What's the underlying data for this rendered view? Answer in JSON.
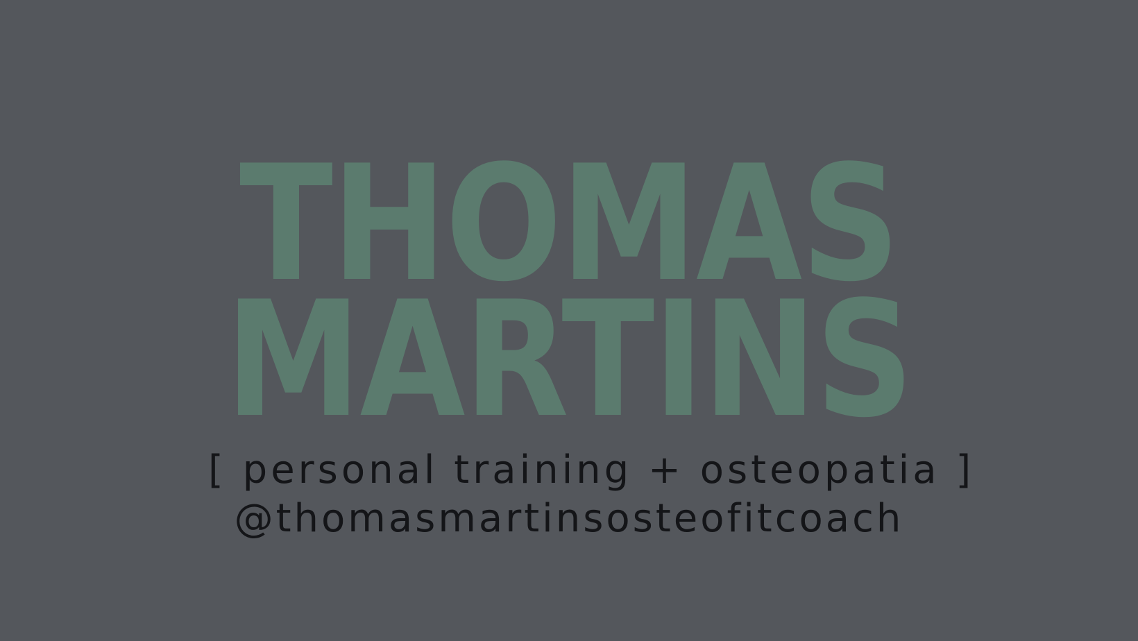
{
  "logo": {
    "first_name": "THOMAS",
    "last_name": "MARTINS",
    "color": "#5b7b6e"
  },
  "tagline": "[ personal training + osteopatia ]",
  "handle": "@thomasmartinsosteofitcoach",
  "colors": {
    "background": "#54575c",
    "text": "#141518"
  }
}
